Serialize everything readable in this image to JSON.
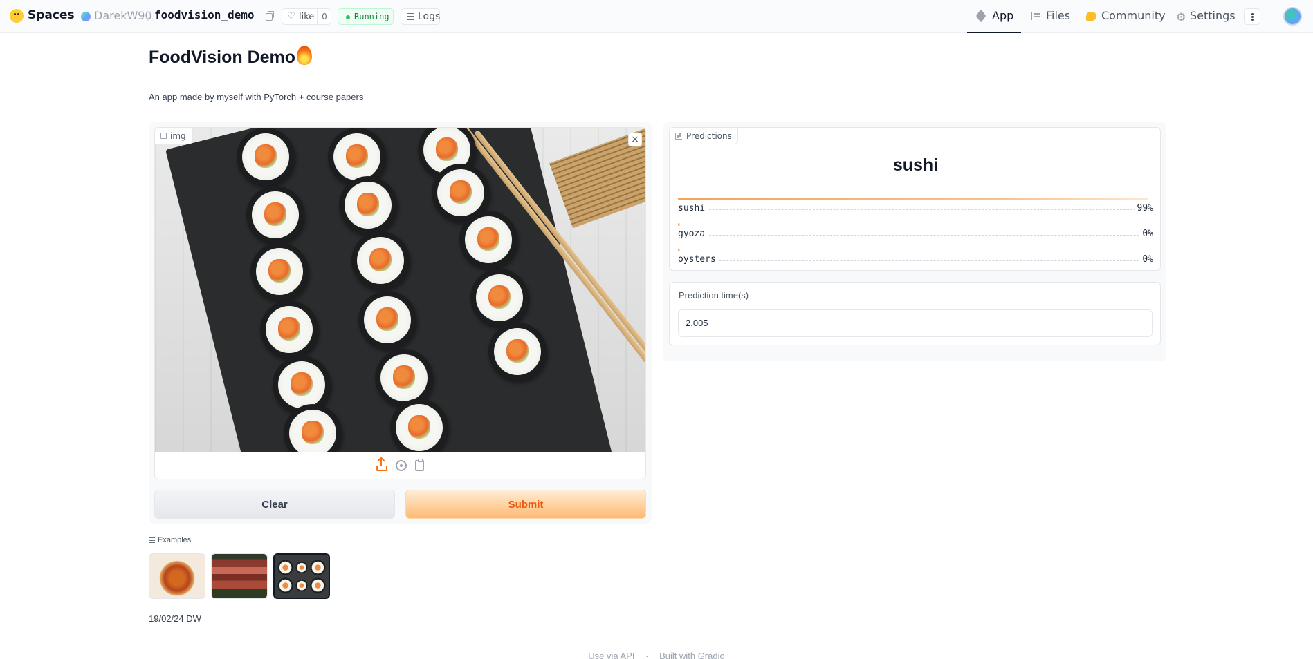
{
  "header": {
    "spaces_label": "Spaces",
    "owner": "DarekW90",
    "separator": "/",
    "repo": "foodvision_demo",
    "like_label": "like",
    "like_count": "0",
    "status": "Running",
    "logs_label": "Logs",
    "tabs": [
      {
        "label": "App",
        "icon": "cube-icon",
        "active": true
      },
      {
        "label": "Files",
        "icon": "files-icon",
        "active": false
      },
      {
        "label": "Community",
        "icon": "community-icon",
        "active": false
      },
      {
        "label": "Settings",
        "icon": "gear-icon",
        "active": false
      }
    ]
  },
  "app": {
    "title": "FoodVision Demo",
    "title_emoji": "fire-emoji",
    "description": "An app made by myself with PyTorch + course papers",
    "input": {
      "label": "img",
      "close_symbol": "×"
    },
    "buttons": {
      "clear": "Clear",
      "submit": "Submit"
    },
    "predictions": {
      "label": "Predictions",
      "top_label": "sushi",
      "rows": [
        {
          "name": "sushi",
          "percent": "99%",
          "fraction": 0.99
        },
        {
          "name": "gyoza",
          "percent": "0%",
          "fraction": 0.0
        },
        {
          "name": "oysters",
          "percent": "0%",
          "fraction": 0.0
        }
      ]
    },
    "prediction_time": {
      "label": "Prediction time(s)",
      "value": "2,005"
    },
    "examples": {
      "label": "Examples",
      "items": [
        "pizza",
        "steak",
        "sushi"
      ],
      "selected": 2
    },
    "article": "19/02/24 DW"
  },
  "footer": {
    "api_link": "Use via API",
    "separator": "·",
    "built_with": "Built with Gradio"
  },
  "colors": {
    "accent": "#f97316",
    "submit_text": "#ea580c",
    "running": "#22c55e"
  }
}
